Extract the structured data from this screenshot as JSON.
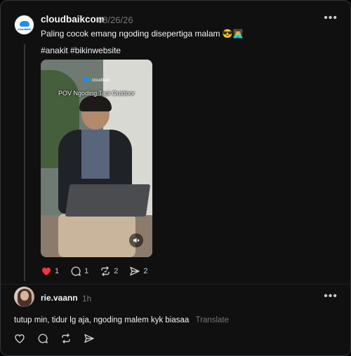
{
  "post": {
    "avatar_label": "cloudbaik",
    "username": "cloudbaikcom",
    "date": "08/26/26",
    "caption": "Paling cocok emang ngoding disepertiga malam",
    "caption_emoji": "😎👨‍💻",
    "tags": "#anakit #bikinwebsite",
    "video": {
      "overlay_brand": "cloudbaik",
      "overlay_text": "POV Ngoding Tapi Outdoor",
      "mute_icon": "speaker-muted-icon"
    },
    "actions": {
      "likes": "1",
      "comments": "1",
      "reposts": "2",
      "shares": "2"
    },
    "accent_like": "#ff3040"
  },
  "reply": {
    "username": "rie.vaann",
    "time": "1h",
    "text": "tutup min, tidur lg aja, ngoding malem kyk biasaa",
    "translate": "Translate"
  }
}
